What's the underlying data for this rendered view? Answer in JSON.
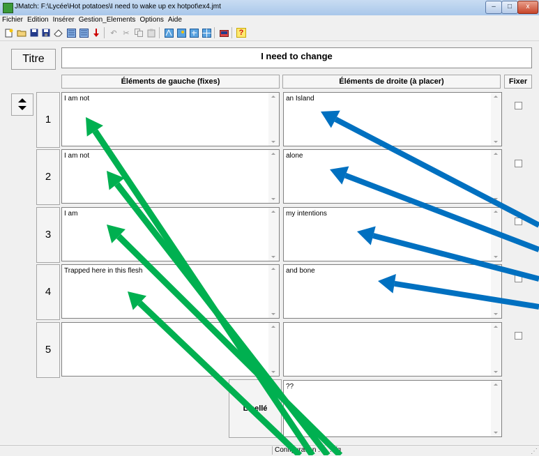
{
  "window": {
    "title": "JMatch: F:\\Lycée\\Hot potatoes\\I need to wake up ex hotpot\\ex4.jmt",
    "min_glyph": "–",
    "max_glyph": "□",
    "close_glyph": "x"
  },
  "menu": [
    "Fichier",
    "Edition",
    "Insérer",
    "Gestion_Elements",
    "Options",
    "Aide"
  ],
  "toolbar_icons": [
    "new-file-icon",
    "open-folder-icon",
    "save-icon",
    "save-as-icon",
    "eraser-icon",
    "web-page-icon",
    "web-page-drag-icon",
    "arrow-down-icon",
    "undo-icon",
    "cut-icon",
    "copy-icon",
    "paste-icon",
    "add-text-icon",
    "insert-picture-icon",
    "link-icon",
    "table-icon",
    "config-icon",
    "help-icon"
  ],
  "title_button": "Titre",
  "title_value": "I need to change",
  "headers": {
    "left": "Éléments de gauche (fixes)",
    "right": "Éléments de droite (à placer)",
    "fix": "Fixer"
  },
  "rows": [
    {
      "num": "1",
      "left": "I am not",
      "right": "an Island"
    },
    {
      "num": "2",
      "left": "I am not",
      "right": "alone"
    },
    {
      "num": "3",
      "left": "I am",
      "right": "my intentions"
    },
    {
      "num": "4",
      "left": "Trapped here in this flesh",
      "right": "and bone"
    },
    {
      "num": "5",
      "left": "",
      "right": ""
    }
  ],
  "libelle": {
    "button": "Libellé",
    "value": "??"
  },
  "status": "Configuration : ... .cfg",
  "annotation_colors": {
    "green": "#00b050",
    "blue": "#0070c0"
  }
}
